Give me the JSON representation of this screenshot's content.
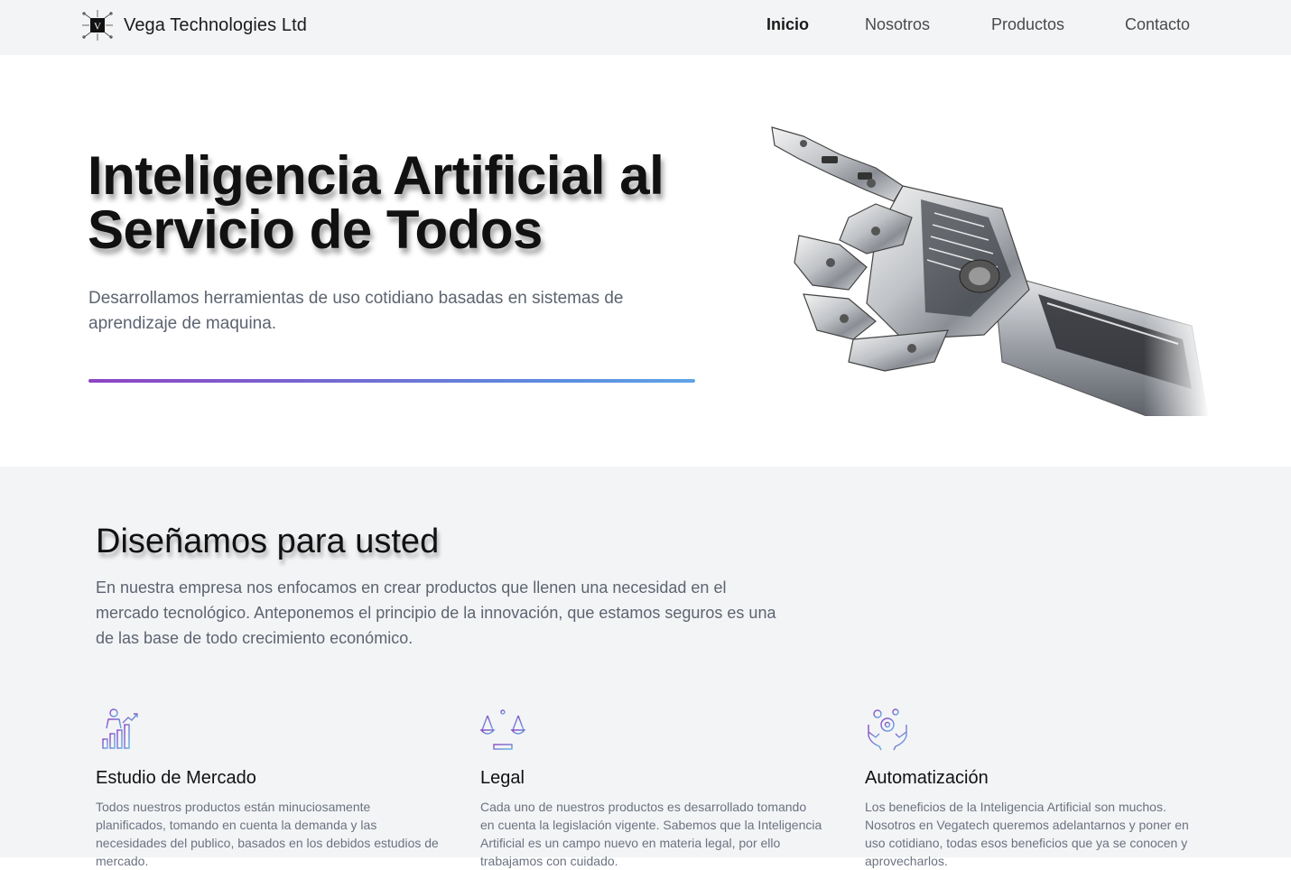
{
  "nav": {
    "brand_name": "Vega Technologies Ltd",
    "logo_letter": "V",
    "links": [
      {
        "label": "Inicio",
        "active": true
      },
      {
        "label": "Nosotros",
        "active": false
      },
      {
        "label": "Productos",
        "active": false
      },
      {
        "label": "Contacto",
        "active": false
      }
    ]
  },
  "hero": {
    "title": "Inteligencia Artificial al Servicio de Todos",
    "subtitle": "Desarrollamos herramientas de uso cotidiano basadas en sistemas de aprendizaje de maquina.",
    "image": "robotic-hand"
  },
  "section": {
    "title": "Diseñamos para usted",
    "text": "En nuestra empresa nos enfocamos en crear productos que llenen una necesidad en el mercado tecnológico. Anteponemos el principio de la innovación, que estamos seguros es una de las base de todo crecimiento económico.",
    "features": [
      {
        "icon": "market-study-icon",
        "title": "Estudio de Mercado",
        "text": "Todos nuestros productos están minuciosamente planificados, tomando en cuenta la demanda y las necesidades del publico, basados en los debidos estudios de mercado."
      },
      {
        "icon": "scales-icon",
        "title": "Legal",
        "text": "Cada uno de nuestros productos es desarrollado tomando en cuenta la legislación vigente. Sabemos que la Inteligencia Artificial es un campo nuevo en materia legal, por ello trabajamos con cuidado."
      },
      {
        "icon": "automation-icon",
        "title": "Automatización",
        "text": "Los beneficios de la Inteligencia Artificial son muchos. Nosotros en Vegatech queremos adelantarnos y poner en uso cotidiano, todas esos beneficios que ya se conocen y aprovecharlos."
      }
    ]
  },
  "colors": {
    "gradient_start": "#8e44c4",
    "gradient_end": "#61a4e6",
    "nav_bg": "#f3f4f6"
  }
}
